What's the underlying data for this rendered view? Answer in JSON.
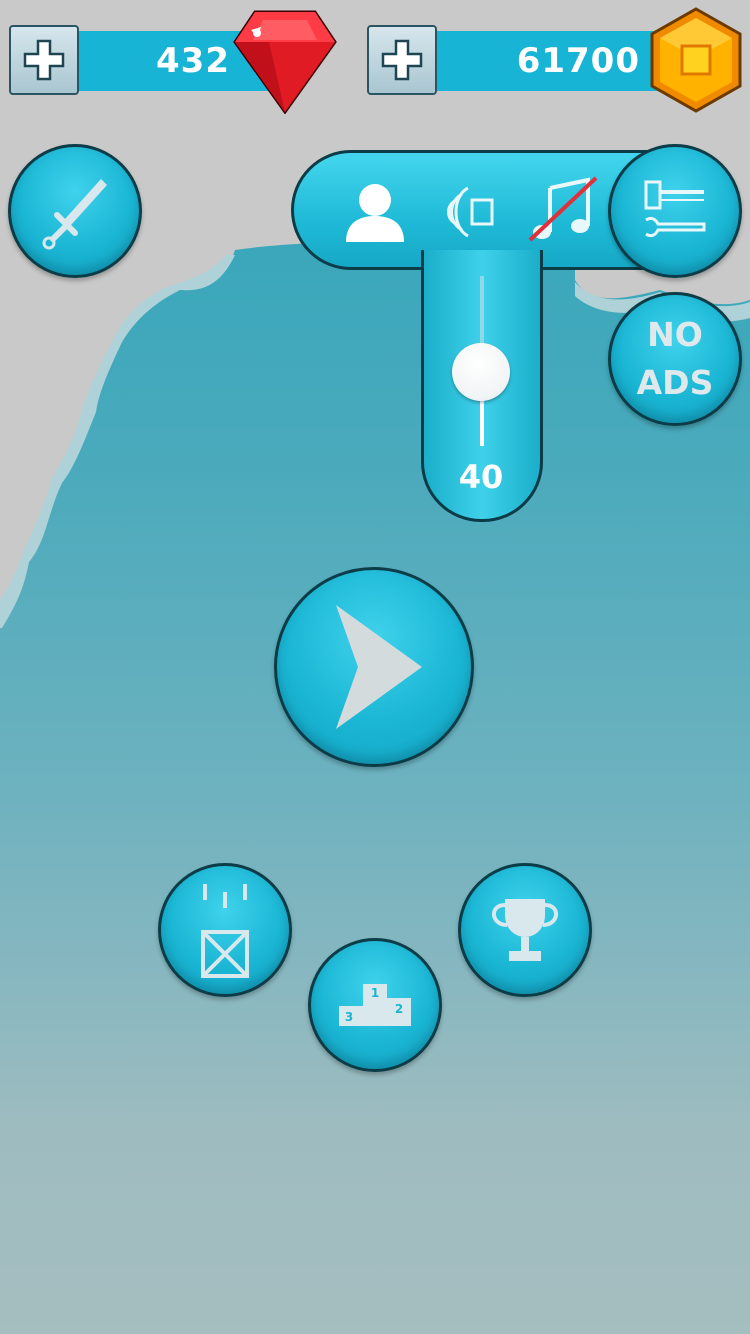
{
  "currency": {
    "gems": {
      "value": "432",
      "icon": "red-gem-icon",
      "add_icon": "plus-icon"
    },
    "coins": {
      "value": "61700",
      "icon": "gold-coin-icon",
      "add_icon": "plus-icon"
    }
  },
  "buttons": {
    "weapons": {
      "icon": "sword-icon"
    },
    "tools": {
      "icon": "hammer-wrench-icon"
    },
    "no_ads": {
      "line1": "NO",
      "line2": "ADS"
    },
    "play": {
      "icon": "play-icon"
    },
    "crate": {
      "icon": "falling-crate-icon"
    },
    "leaderboard": {
      "icon": "podium-icon",
      "podium_numbers": [
        "1",
        "2",
        "3"
      ]
    },
    "achievements": {
      "icon": "trophy-icon"
    }
  },
  "settings": {
    "items": [
      {
        "name": "profile",
        "icon": "person-icon",
        "enabled": true
      },
      {
        "name": "sound",
        "icon": "speaker-icon",
        "enabled": true
      },
      {
        "name": "music",
        "icon": "music-note-icon",
        "enabled": false
      }
    ],
    "volume": {
      "value": "40",
      "level": 0.4
    }
  },
  "colors": {
    "button_fill": "#1ab6d4",
    "bar_fill": "#17b4d6",
    "outline": "#0c3c47",
    "gem": "#e01b24",
    "coin": "#f5a000",
    "muted_line": "#e0303a"
  }
}
